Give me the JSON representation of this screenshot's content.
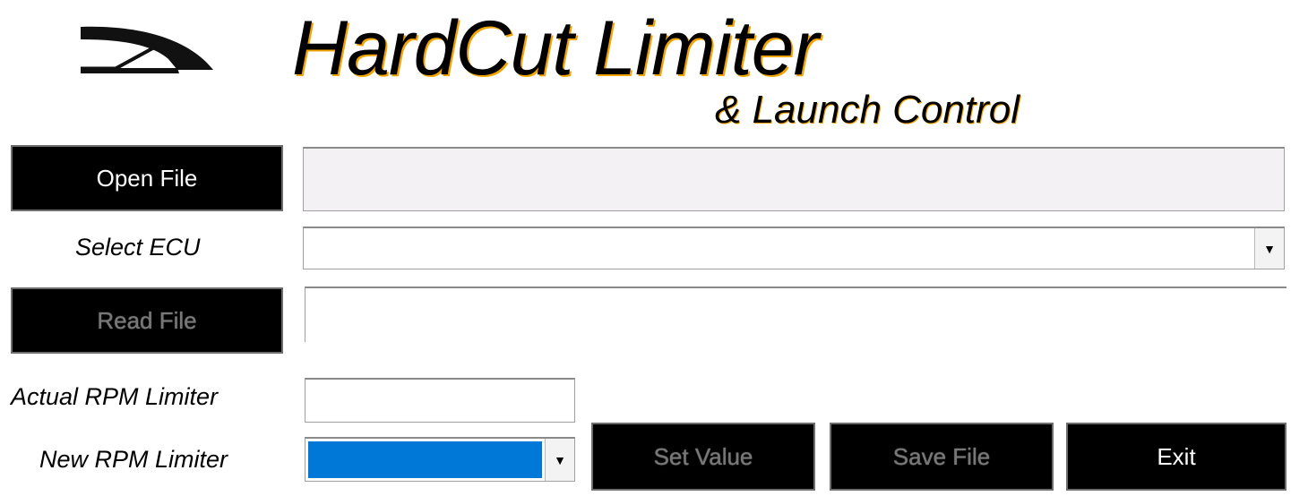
{
  "header": {
    "title": "HardCut Limiter",
    "subtitle": "& Launch Control",
    "logo_icon": "speedometer-gauge-icon"
  },
  "file": {
    "open_label": "Open File",
    "path_value": ""
  },
  "ecu": {
    "label": "Select ECU",
    "selected": ""
  },
  "read": {
    "label": "Read File",
    "output": ""
  },
  "rpm": {
    "actual_label": "Actual RPM Limiter",
    "actual_value": "",
    "new_label": "New RPM Limiter",
    "new_selected": ""
  },
  "actions": {
    "set_label": "Set Value",
    "save_label": "Save File",
    "exit_label": "Exit"
  },
  "colors": {
    "accent": "#f0a500",
    "selection": "#0078d7",
    "button_bg": "#000000"
  }
}
